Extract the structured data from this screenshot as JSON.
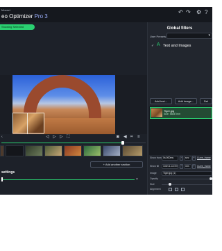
{
  "app": {
    "brand_top": "Movavi",
    "title_prefix": "eo Optimizer ",
    "title_version": "Pro 3"
  },
  "status": {
    "label": "Showing Selected"
  },
  "toolbar": {
    "import_label": "Import...",
    "undo_icon": "undo-icon",
    "redo_icon": "redo-icon",
    "settings_icon": "gear-icon",
    "help_icon": "help-icon"
  },
  "filters": {
    "title": "Global filters",
    "user_presets_label": "User Presets",
    "section_label": "Text and Images",
    "add_text_label": "Add text...",
    "add_image_label": "Add image...",
    "third_button_label": "Del",
    "images": [
      {
        "name": "Tiger.jpg",
        "size": "Size: 58x47mm"
      }
    ],
    "show_from_label": "Show from",
    "show_from_value": "0s:000ms",
    "show_from_btn1": "",
    "show_from_unit": "sec",
    "show_from_link": "Curre_frame",
    "show_till_label": "Show till",
    "show_till_value": "1min:1.d-47mm",
    "show_till_unit": "min",
    "show_till_link": "Curre_frame",
    "image_label": "Image",
    "image_value": "Tiger.jpg (1)",
    "opacity_label": "Opacity",
    "size_label": "Size",
    "alignment_label": "Alignment"
  },
  "editor": {
    "add_section_label": "+ Add another section",
    "settings_title": "settings"
  },
  "colors": {
    "accent": "#2ad071",
    "background": "#1d2129",
    "panel": "#22262e"
  }
}
